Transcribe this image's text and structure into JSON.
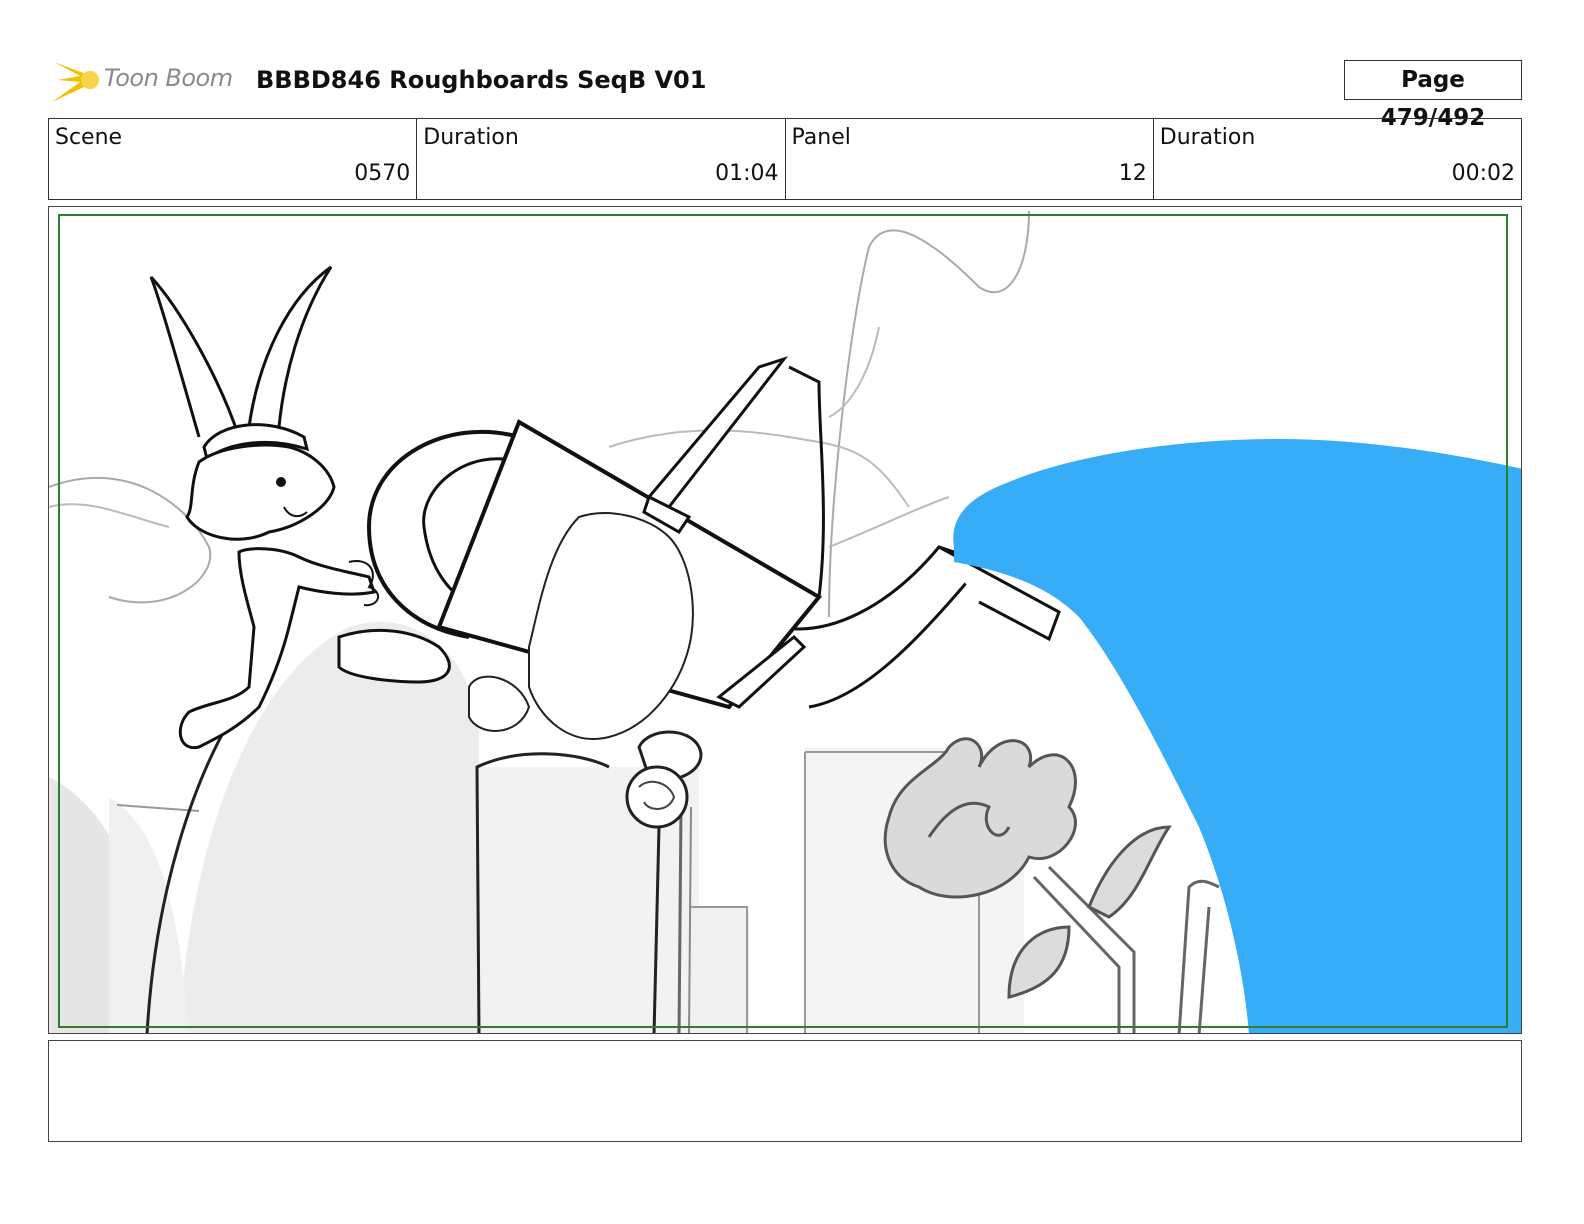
{
  "header": {
    "logo_text": "Toon Boom",
    "title": "BBBD846 Roughboards SeqB V01",
    "page": "Page 479/492"
  },
  "info": [
    {
      "label": "Scene",
      "value": "0570"
    },
    {
      "label": "Duration",
      "value": "01:04"
    },
    {
      "label": "Panel",
      "value": "12"
    },
    {
      "label": "Duration",
      "value": "00:02"
    }
  ],
  "notes": "",
  "colors": {
    "safe_frame": "#2e7d32",
    "water": "#38adf7",
    "logo_accent": "#f5c000"
  }
}
